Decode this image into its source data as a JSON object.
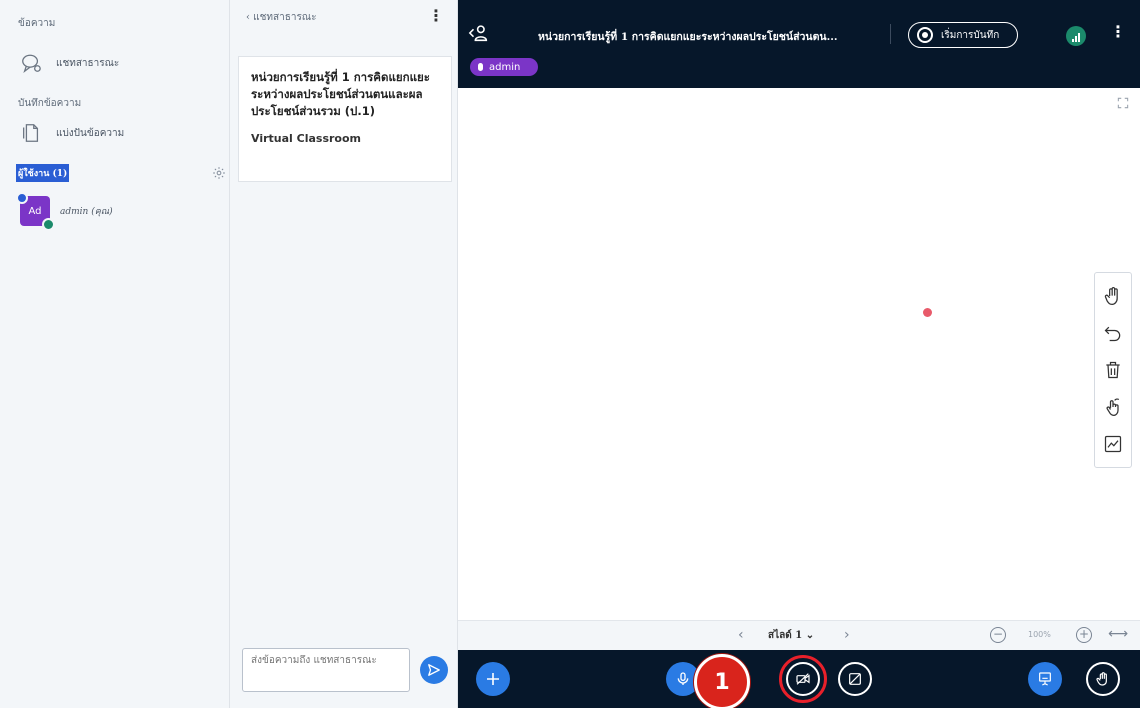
{
  "sidebar": {
    "messages_title": "ข้อความ",
    "public_chat_label": "แชทสาธารณะ",
    "notes_title": "บันทึกข้อความ",
    "shared_notes_label": "แบ่งปันข้อความ",
    "users_title": "ผู้ใช้งาน (1)",
    "user": {
      "avatar_initials": "Ad",
      "name": "admin (คุณ)"
    }
  },
  "chat": {
    "back_label": "‹ แชทสาธารณะ",
    "menu_label": "⋮",
    "welcome_title": "หน่วยการเรียนรู้ที่ 1 การคิดแยกแยะระหว่างผลประโยชน์ส่วนตนและผลประโยชน์ส่วนรวม (ป.1)",
    "welcome_sub": "Virtual Classroom",
    "input_placeholder": "ส่งข้อความถึง แชทสาธารณะ"
  },
  "topbar": {
    "meeting_title": "หน่วยการเรียนรู้ที่ 1 การคิดแยกแยะระหว่างผลประโยชน์ส่วนตน...",
    "record_label": "เริ่มการบันทึก",
    "options_label": "⋮",
    "talking_user": "admin"
  },
  "slide_nav": {
    "prev": "‹",
    "slide_label": "สไลด์ 1",
    "dropdown": "⌄",
    "next": "›",
    "zoom_out": "−",
    "zoom_value": "100%",
    "zoom_in": "+",
    "fit": "⟷"
  },
  "annotation": {
    "step_number": "1"
  },
  "colors": {
    "accent_blue": "#2a7be4",
    "dark_bar": "#06172a",
    "avatar_purple": "#7b35c7",
    "highlight_red": "#e8202a"
  },
  "icons": {
    "public_chat": "chat-bubble-icon",
    "shared_notes": "notes-icon",
    "whiteboard_tools": [
      "hand-icon",
      "undo-icon",
      "trash-icon",
      "multi-user-icon",
      "chart-icon"
    ],
    "action_bar": [
      "plus-icon",
      "microphone-icon",
      "video-off-icon",
      "screenshare-off-icon",
      "presentation-icon",
      "raise-hand-icon"
    ]
  }
}
